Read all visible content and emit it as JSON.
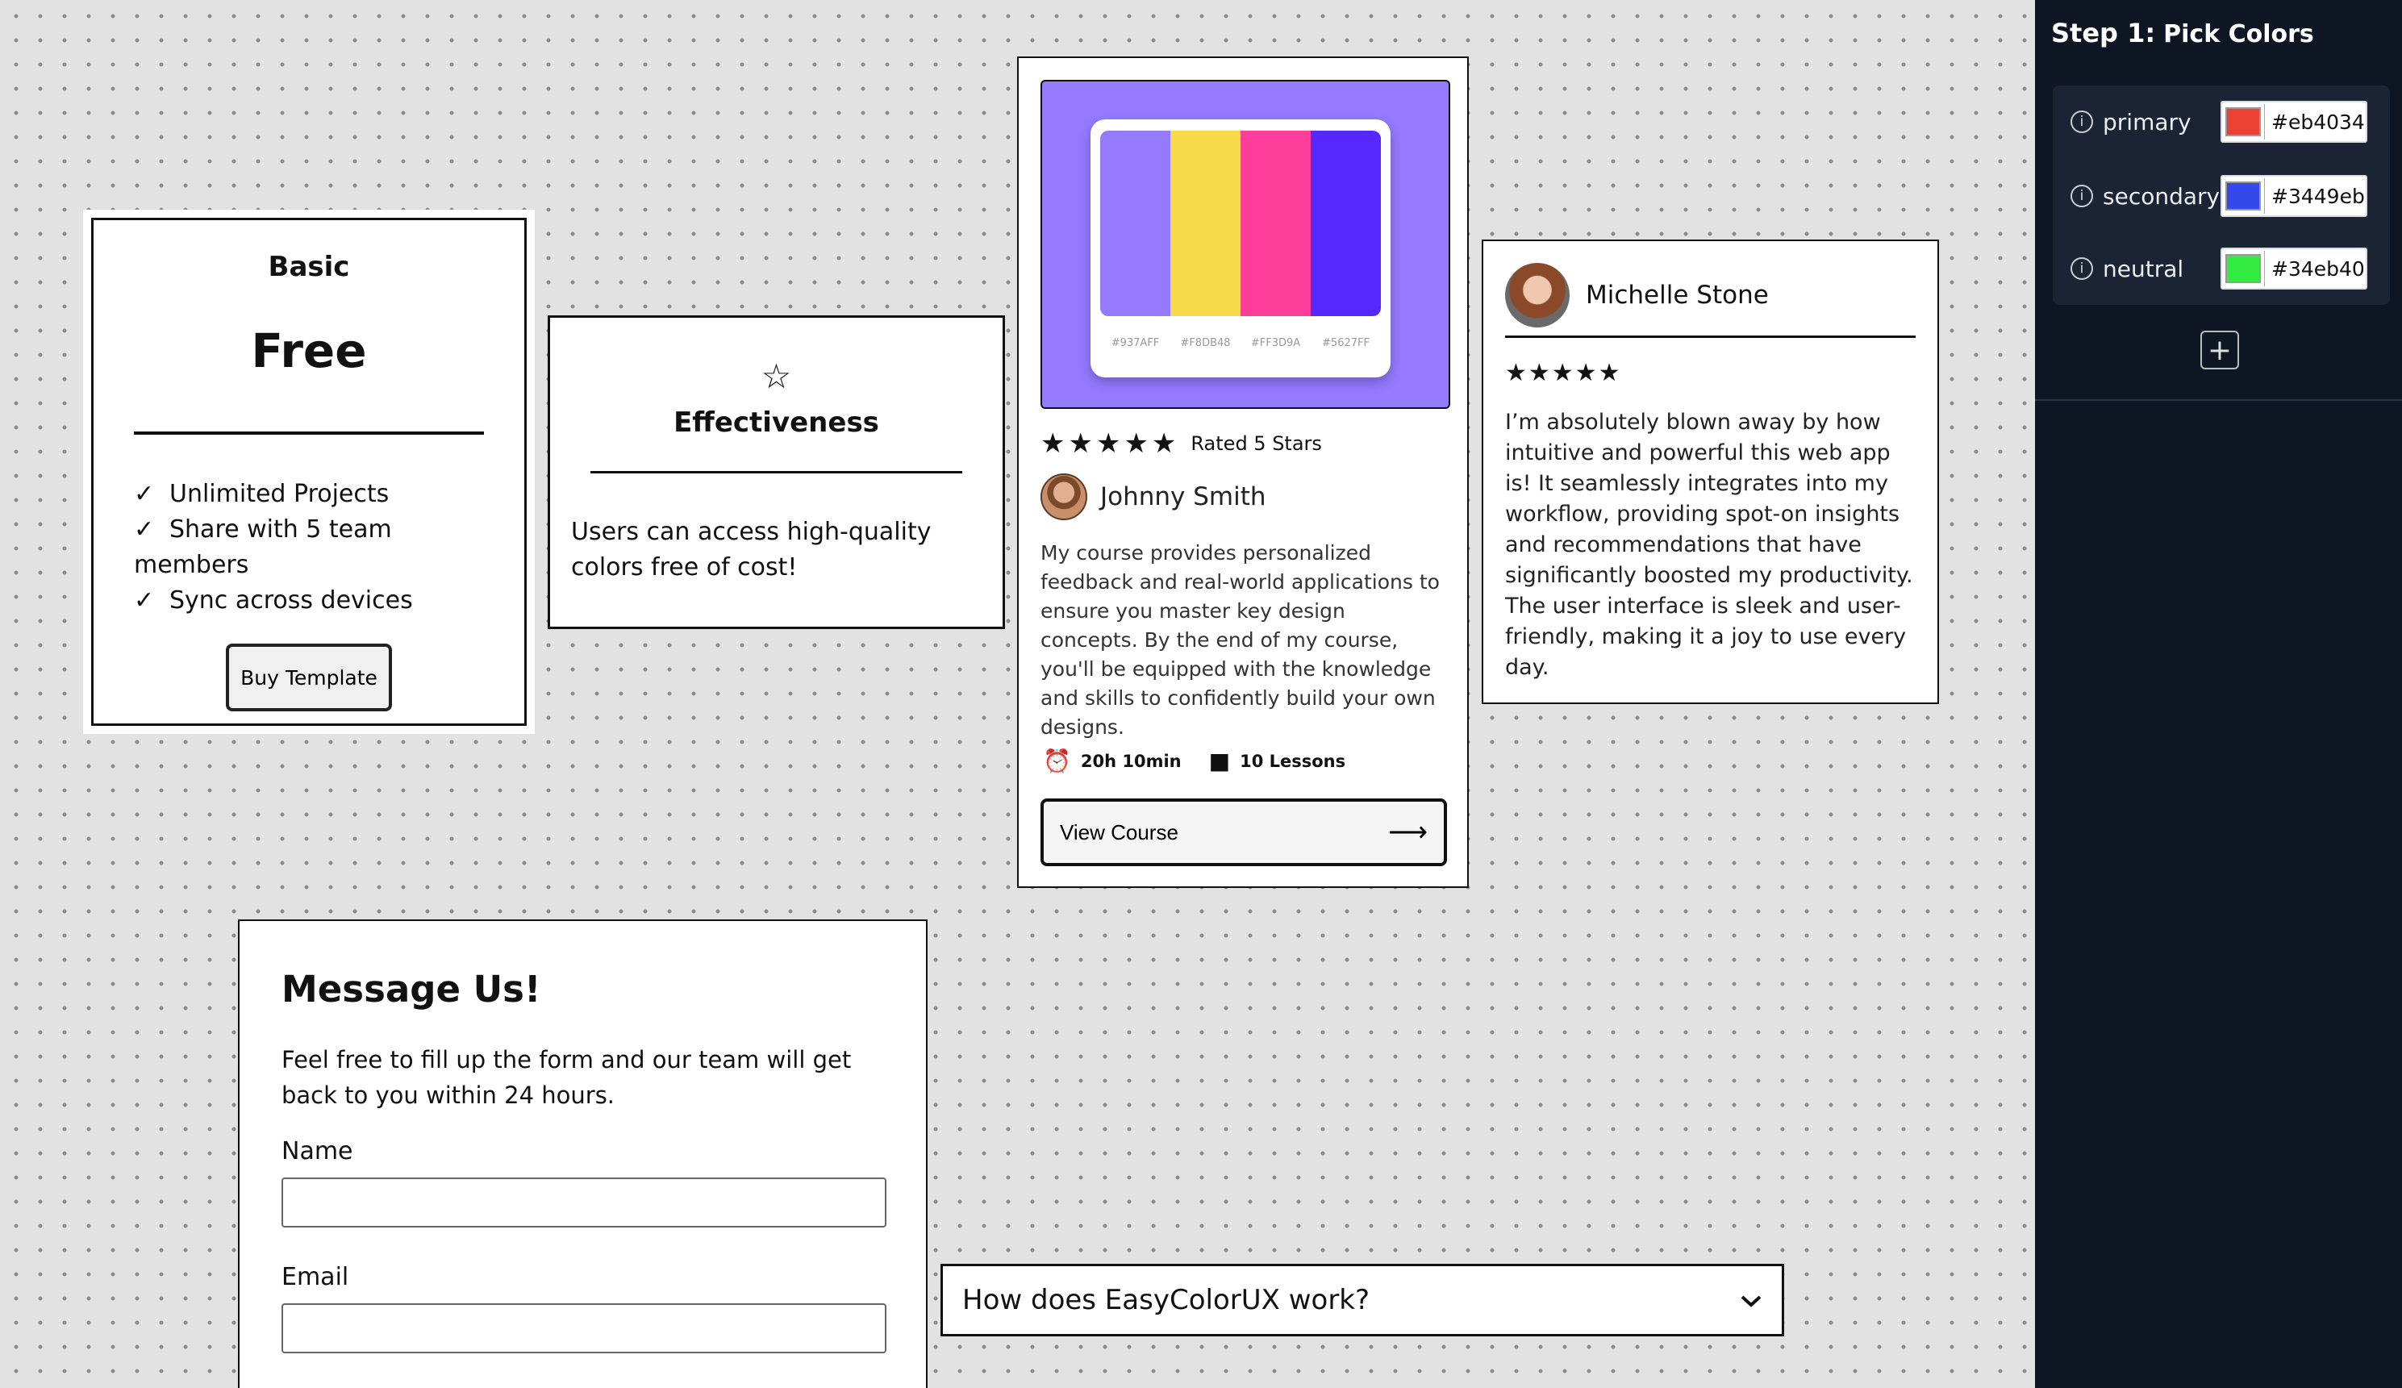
{
  "pricing": {
    "plan": "Basic",
    "price": "Free",
    "features": [
      "Unlimited Projects",
      "Share with 5 team members",
      "Sync across devices"
    ],
    "check": "✓",
    "button_label": "Buy Template"
  },
  "feature": {
    "star": "☆",
    "title": "Effectiveness",
    "description": "Users can access high-quality colors free of cost!"
  },
  "course": {
    "palette": [
      {
        "color": "#937AFF",
        "label": "#937AFF"
      },
      {
        "color": "#F8DB48",
        "label": "#F8DB48"
      },
      {
        "color": "#FF3D9A",
        "label": "#FF3D9A"
      },
      {
        "color": "#5627FF",
        "label": "#5627FF"
      }
    ],
    "stars": "★★★★★",
    "rating_text": "Rated 5 Stars",
    "author": "Johnny Smith",
    "body": "My course provides personalized feedback and real-world applications to ensure you master key design concepts. By the end of my course, you'll be equipped with the knowledge and skills to confidently build your own designs.",
    "duration_icon": "alarm-clock-icon",
    "duration": "20h 10min",
    "lessons_icon": "book-icon",
    "lessons": "10 Lessons",
    "button_label": "View Course",
    "button_arrow": "⟶"
  },
  "testimonial": {
    "name": "Michelle Stone",
    "stars": "★★★★★",
    "quote": "I’m absolutely blown away by how intuitive and powerful this web app is! It seamlessly integrates into my workflow, providing spot-on insights and recommendations that have significantly boosted my productivity. The user interface is sleek and user-friendly, making it a joy to use every day."
  },
  "contact": {
    "title": "Message Us!",
    "description": "Feel free to fill up the form and our team will get back to you within 24 hours.",
    "name_label": "Name",
    "name_value": "",
    "email_label": "Email",
    "email_value": ""
  },
  "faq": {
    "question": "How does EasyColorUX work?",
    "chevron": "⌄"
  },
  "sidebar": {
    "step_label": "Step 1:",
    "step_title": "Pick Colors",
    "info_glyph": "i",
    "colors": [
      {
        "name": "primary",
        "hex": "#eb4034"
      },
      {
        "name": "secondary",
        "hex": "#3449eb"
      },
      {
        "name": "neutral",
        "hex": "#34eb40"
      }
    ],
    "add_glyph": "+"
  }
}
